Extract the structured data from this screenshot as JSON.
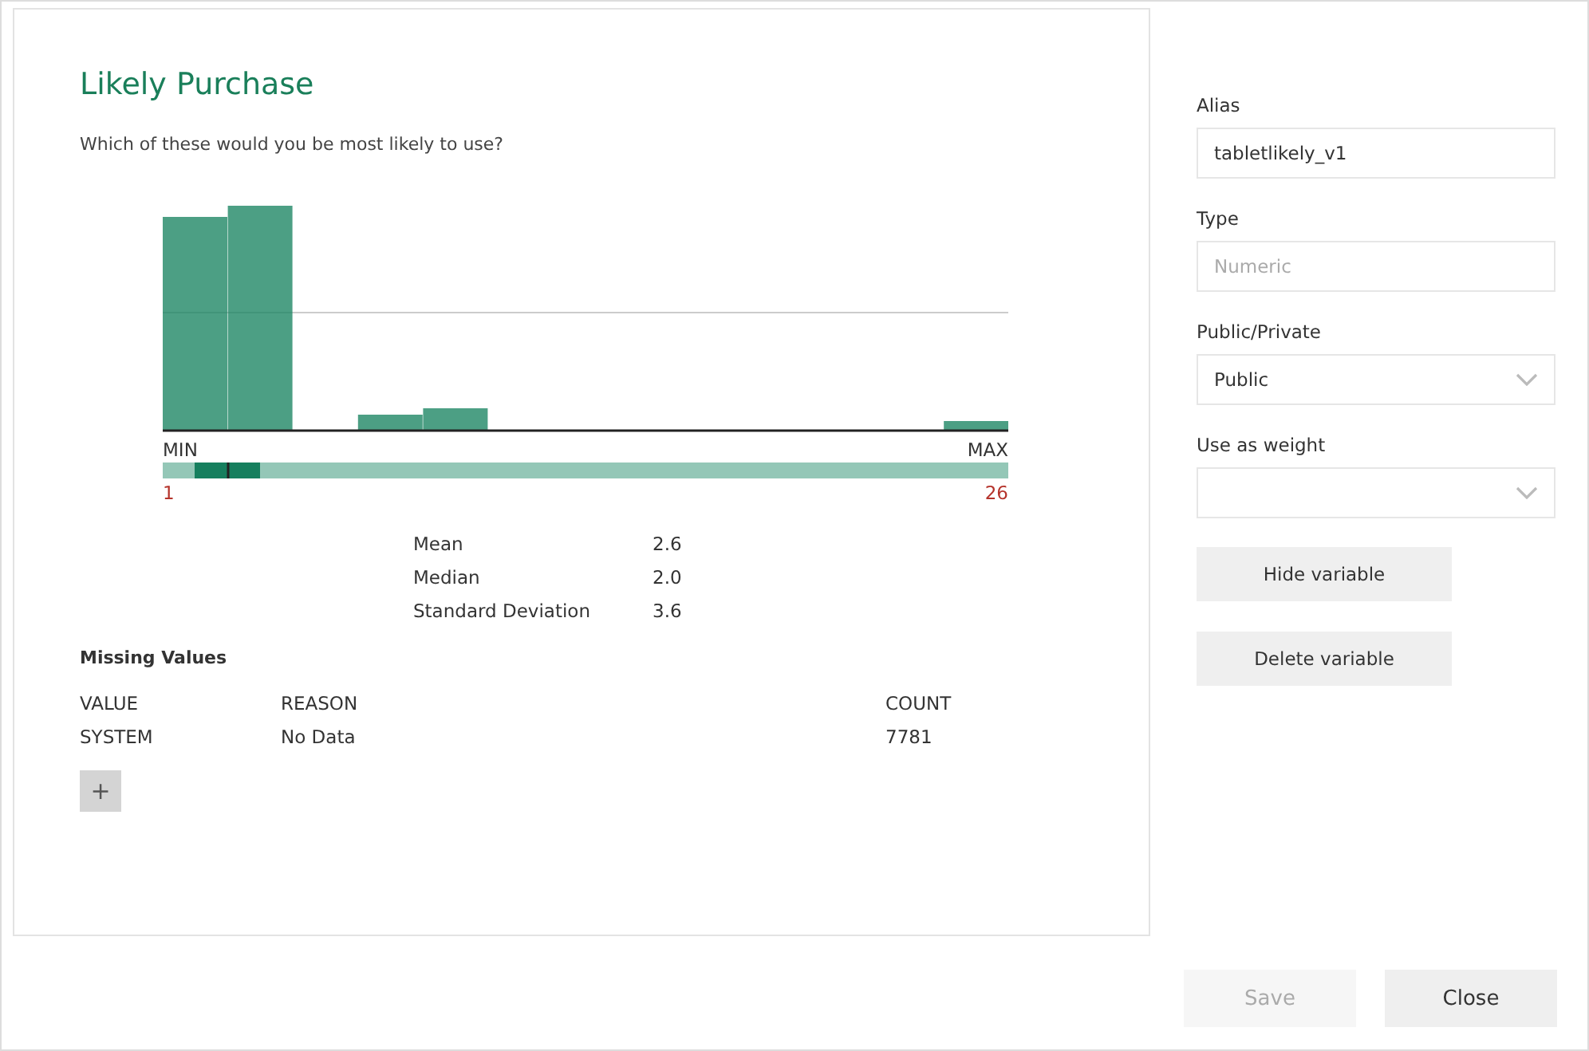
{
  "variable": {
    "title": "Likely Purchase",
    "question": "Which of these would you be most likely to use?"
  },
  "histogram": {
    "min_label": "MIN",
    "max_label": "MAX",
    "min_value": "1",
    "max_value": "26"
  },
  "stats": [
    {
      "label": "Mean",
      "value": "2.6"
    },
    {
      "label": "Median",
      "value": "2.0"
    },
    {
      "label": "Standard Deviation",
      "value": "3.6"
    }
  ],
  "missing_values": {
    "title": "Missing Values",
    "columns": [
      "VALUE",
      "REASON",
      "COUNT"
    ],
    "rows": [
      [
        "SYSTEM",
        "No Data",
        "7781"
      ]
    ],
    "add_button": "+"
  },
  "properties": [
    {
      "kind": "text",
      "label": "Alias",
      "value": "tabletlikely_v1"
    },
    {
      "kind": "text",
      "label": "Type",
      "placeholder": "Numeric"
    },
    {
      "kind": "select",
      "label": "Public/Private",
      "value": "Public"
    },
    {
      "kind": "select",
      "label": "Use as weight"
    }
  ],
  "actions": [
    "Hide variable",
    "Delete variable"
  ],
  "footer": [
    {
      "label": "Save",
      "disabled": true
    },
    {
      "label": "Close",
      "disabled": false
    }
  ]
}
